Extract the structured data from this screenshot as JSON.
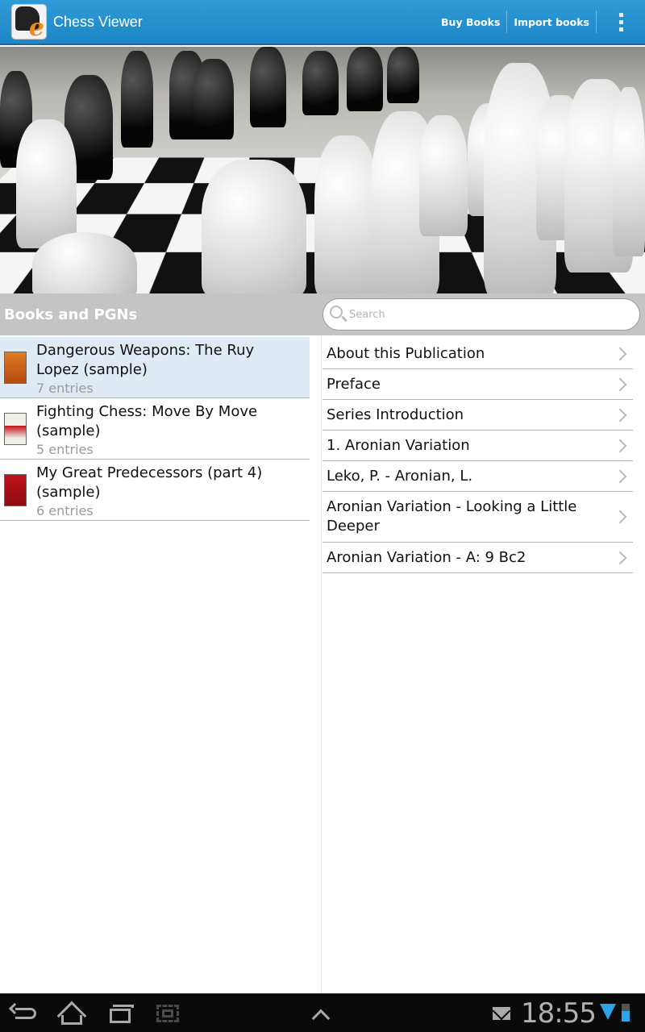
{
  "app": {
    "title": "Chess Viewer",
    "accent_color": "#2590d0",
    "actions": [
      "Buy Books",
      "Import books"
    ]
  },
  "section": {
    "title": "Books and PGNs",
    "search_placeholder": "Search"
  },
  "books": [
    {
      "title": "Dangerous Weapons: The Ruy Lopez (sample)",
      "count": "7 entries",
      "selected": true,
      "cover_color": "#e07a22"
    },
    {
      "title": "Fighting Chess: Move By Move (sample)",
      "count": "5 entries",
      "selected": false,
      "cover_color": "#f0efe6"
    },
    {
      "title": "My Great Predecessors (part 4) (sample)",
      "count": "6 entries",
      "selected": false,
      "cover_color": "#c1121b"
    }
  ],
  "entries": [
    "About this Publication",
    "Preface",
    "Series Introduction",
    "1. Aronian Variation",
    "Leko, P. - Aronian, L.",
    "Aronian Variation - Looking a Little Deeper",
    "Aronian Variation - A: 9 Bc2"
  ],
  "status_bar": {
    "time": "18:55"
  }
}
